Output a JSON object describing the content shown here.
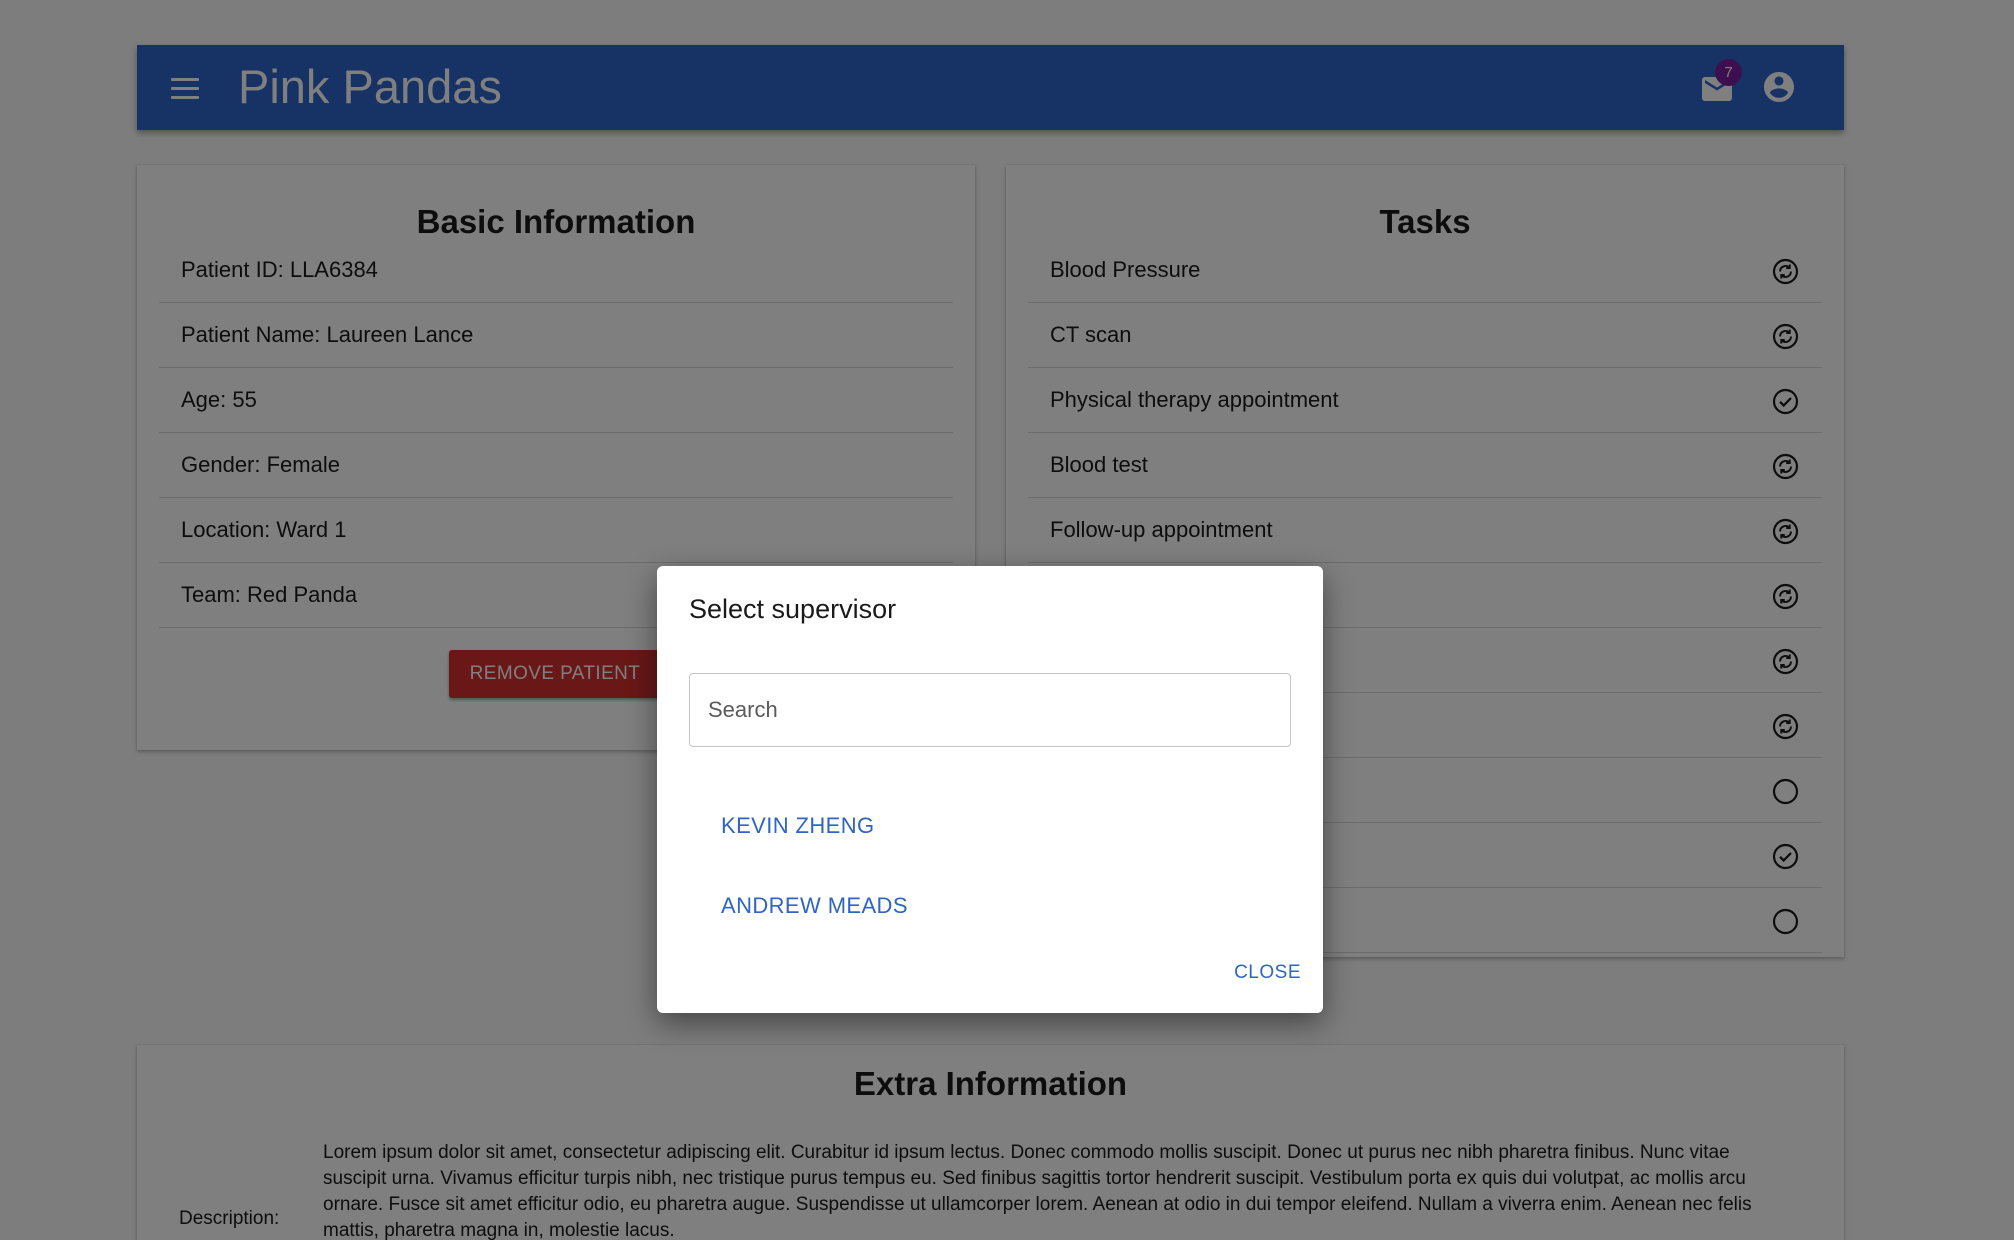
{
  "app": {
    "title": "Pink Pandas",
    "mail_badge": "7"
  },
  "basic_info": {
    "title": "Basic Information",
    "rows": [
      "Patient ID: LLA6384",
      "Patient Name: Laureen Lance",
      "Age: 55",
      "Gender: Female",
      "Location: Ward 1",
      "Team: Red Panda"
    ],
    "remove_label": "REMOVE PATIENT"
  },
  "tasks": {
    "title": "Tasks",
    "items": [
      {
        "label": "Blood Pressure",
        "icon": "in-progress-icon"
      },
      {
        "label": "CT scan",
        "icon": "in-progress-icon"
      },
      {
        "label": "Physical therapy appointment",
        "icon": "check-circle-icon"
      },
      {
        "label": "Blood test",
        "icon": "in-progress-icon"
      },
      {
        "label": "Follow-up appointment",
        "icon": "in-progress-icon"
      },
      {
        "label": "",
        "icon": "in-progress-icon"
      },
      {
        "label": "",
        "icon": "in-progress-icon"
      },
      {
        "label": "",
        "icon": "in-progress-icon"
      },
      {
        "label": "",
        "icon": "empty-circle-icon"
      },
      {
        "label": "",
        "icon": "check-circle-icon"
      },
      {
        "label": "",
        "icon": "empty-circle-icon"
      }
    ]
  },
  "extra_info": {
    "title": "Extra Information",
    "description_label": "Description:",
    "description": "Lorem ipsum dolor sit amet, consectetur adipiscing elit. Curabitur id ipsum lectus. Donec commodo mollis suscipit. Donec ut purus nec nibh pharetra finibus. Nunc vitae suscipit urna. Vivamus efficitur turpis nibh, nec tristique purus tempus eu. Sed finibus sagittis tortor hendrerit suscipit. Vestibulum porta ex quis dui volutpat, ac mollis arcu ornare. Fusce sit amet efficitur odio, eu pharetra augue. Suspendisse ut ullamcorper lorem. Aenean at odio in dui tempor eleifend. Nullam a viverra enim. Aenean nec felis mattis, pharetra magna in, molestie lacus."
  },
  "dialog": {
    "title": "Select supervisor",
    "search_placeholder": "Search",
    "options": [
      "KEVIN ZHENG",
      "ANDREW MEADS"
    ],
    "close_label": "CLOSE"
  },
  "colors": {
    "appbar": "#2f64c9",
    "badge": "#7b1fa2",
    "danger": "#d32f2f",
    "link": "#2f64c9"
  }
}
